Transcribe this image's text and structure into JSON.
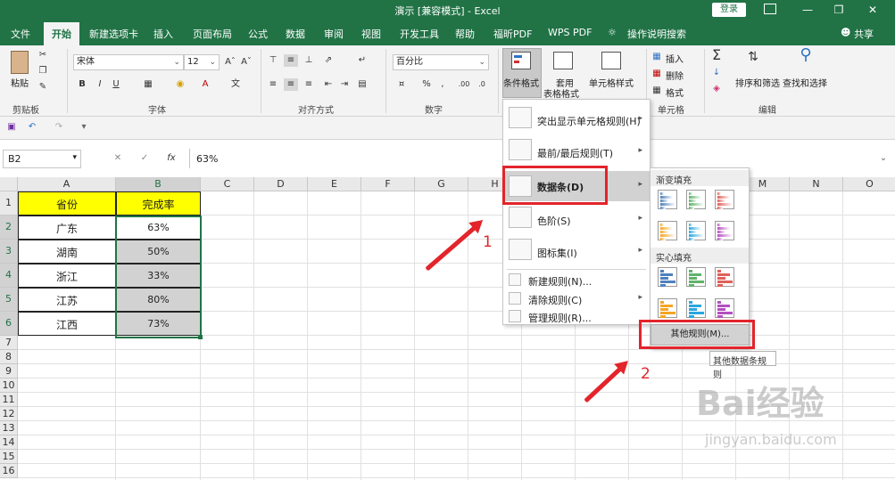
{
  "window": {
    "title": "演示 [兼容模式] - Excel",
    "login": "登录",
    "minimize": "—",
    "restore": "❐",
    "close": "✕"
  },
  "tabs": [
    "文件",
    "开始",
    "新建选项卡",
    "插入",
    "页面布局",
    "公式",
    "数据",
    "审阅",
    "视图",
    "开发工具",
    "帮助",
    "福昕PDF",
    "WPS PDF",
    "操作说明搜索"
  ],
  "share": "共享",
  "ribbon": {
    "groups": {
      "clipboard": "剪贴板",
      "font": "字体",
      "alignment": "对齐方式",
      "number": "数字",
      "cells": "单元格",
      "editing": "编辑"
    },
    "paste": "粘贴",
    "font_name": "宋体",
    "font_size": "12",
    "number_format": "百分比",
    "cond_format": "条件格式",
    "table_format_1": "套用",
    "table_format_2": "表格格式",
    "cell_style": "单元格样式",
    "insert": "插入",
    "delete": "删除",
    "format": "格式",
    "sort_filter": "排序和筛选",
    "find_select": "查找和选择"
  },
  "formula_bar": {
    "name_box": "B2",
    "fx": "fx",
    "value": "63%"
  },
  "columns": [
    "A",
    "B",
    "C",
    "D",
    "E",
    "F",
    "G",
    "H",
    "I",
    "J",
    "K",
    "L",
    "M",
    "N",
    "O"
  ],
  "rows": [
    "1",
    "2",
    "3",
    "4",
    "5",
    "6",
    "7",
    "8",
    "9",
    "10",
    "11",
    "12",
    "13",
    "14",
    "15",
    "16"
  ],
  "table": {
    "headers": [
      "省份",
      "完成率"
    ],
    "rows": [
      [
        "广东",
        "63%"
      ],
      [
        "湖南",
        "50%"
      ],
      [
        "浙江",
        "33%"
      ],
      [
        "江苏",
        "80%"
      ],
      [
        "江西",
        "73%"
      ]
    ]
  },
  "cond_menu": {
    "items": [
      {
        "label": "突出显示单元格规则(H)",
        "icon": "highlight-rules-icon"
      },
      {
        "label": "最前/最后规则(T)",
        "icon": "top-bottom-rules-icon"
      },
      {
        "label": "数据条(D)",
        "icon": "data-bars-icon"
      },
      {
        "label": "色阶(S)",
        "icon": "color-scales-icon"
      },
      {
        "label": "图标集(I)",
        "icon": "icon-sets-icon"
      }
    ],
    "small_items": [
      "新建规则(N)...",
      "清除规则(C)",
      "管理规则(R)..."
    ]
  },
  "data_bar_menu": {
    "gradient": "渐变填充",
    "solid": "实心填充",
    "more": "其他规则(M)...",
    "colors": [
      "#4f81bd",
      "#5fb36a",
      "#e0605a",
      "#f5a623",
      "#2aa7e0",
      "#b44fbf"
    ]
  },
  "tooltip": "其他数据条规则",
  "annotations": [
    "1",
    "2"
  ],
  "watermark": {
    "brand": "Bai经验",
    "url": "jingyan.baidu.com"
  },
  "accent": "#217346"
}
